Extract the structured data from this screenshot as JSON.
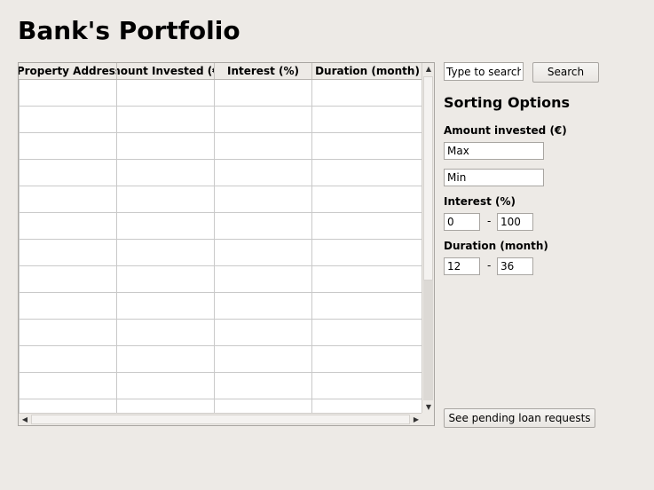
{
  "window": {
    "title": "Bank's Portfolio"
  },
  "table": {
    "columns": [
      "Property Address",
      "Amount Invested (€)",
      "Interest (%)",
      "Duration (month)"
    ],
    "rows": [
      [
        "",
        "",
        "",
        ""
      ],
      [
        "",
        "",
        "",
        ""
      ],
      [
        "",
        "",
        "",
        ""
      ],
      [
        "",
        "",
        "",
        ""
      ],
      [
        "",
        "",
        "",
        ""
      ],
      [
        "",
        "",
        "",
        ""
      ],
      [
        "",
        "",
        "",
        ""
      ],
      [
        "",
        "",
        "",
        ""
      ],
      [
        "",
        "",
        "",
        ""
      ],
      [
        "",
        "",
        "",
        ""
      ],
      [
        "",
        "",
        "",
        ""
      ],
      [
        "",
        "",
        "",
        ""
      ],
      [
        "",
        "",
        "",
        ""
      ]
    ]
  },
  "search": {
    "placeholder": "Type to search...",
    "button_label": "Search"
  },
  "sorting": {
    "title": "Sorting Options",
    "amount": {
      "label": "Amount invested (€)",
      "max_value": "Max",
      "min_value": "Min"
    },
    "interest": {
      "label": "Interest (%)",
      "from_value": "0",
      "separator": "-",
      "to_value": "100"
    },
    "duration": {
      "label": "Duration (month)",
      "from_value": "12",
      "separator": "-",
      "to_value": "36"
    }
  },
  "actions": {
    "pending_label": "See pending loan requests"
  },
  "icons": {
    "scroll_up": "scroll-up-arrow-icon",
    "scroll_down": "scroll-down-arrow-icon",
    "scroll_left": "scroll-left-arrow-icon",
    "scroll_right": "scroll-right-arrow-icon"
  }
}
